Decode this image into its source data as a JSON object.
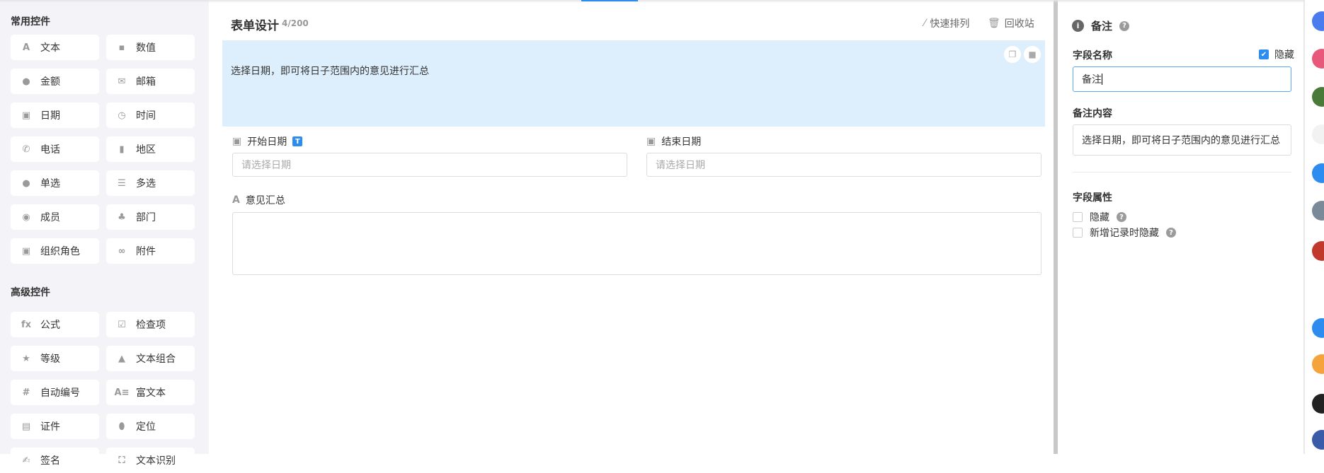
{
  "sidebar": {
    "common_title": "常用控件",
    "common": [
      {
        "label": "文本",
        "icon": "text-icon"
      },
      {
        "label": "数值",
        "icon": "number-icon"
      },
      {
        "label": "金额",
        "icon": "money-icon"
      },
      {
        "label": "邮箱",
        "icon": "mail-icon"
      },
      {
        "label": "日期",
        "icon": "calendar-icon"
      },
      {
        "label": "时间",
        "icon": "clock-icon"
      },
      {
        "label": "电话",
        "icon": "phone-icon"
      },
      {
        "label": "地区",
        "icon": "map-icon"
      },
      {
        "label": "单选",
        "icon": "radio-icon"
      },
      {
        "label": "多选",
        "icon": "checklist-icon"
      },
      {
        "label": "成员",
        "icon": "user-icon"
      },
      {
        "label": "部门",
        "icon": "org-icon"
      },
      {
        "label": "组织角色",
        "icon": "role-icon"
      },
      {
        "label": "附件",
        "icon": "paperclip-icon"
      }
    ],
    "advanced_title": "高级控件",
    "advanced": [
      {
        "label": "公式",
        "icon": "fx-icon"
      },
      {
        "label": "检查项",
        "icon": "checkbox-icon"
      },
      {
        "label": "等级",
        "icon": "star-icon"
      },
      {
        "label": "文本组合",
        "icon": "shapes-icon"
      },
      {
        "label": "自动编号",
        "icon": "hash-icon"
      },
      {
        "label": "富文本",
        "icon": "richtext-icon"
      },
      {
        "label": "证件",
        "icon": "id-card-icon"
      },
      {
        "label": "定位",
        "icon": "location-icon"
      },
      {
        "label": "签名",
        "icon": "signature-icon"
      },
      {
        "label": "文本识别",
        "icon": "ocr-icon"
      }
    ]
  },
  "main": {
    "title": "表单设计",
    "count": "4/200",
    "quick_arrange": "快速排列",
    "recycle_bin": "回收站",
    "note_text": "选择日期，即可将日子范围内的意见进行汇总",
    "start_date_label": "开始日期",
    "start_date_badge": "T",
    "end_date_label": "结束日期",
    "date_placeholder": "请选择日期",
    "summary_label": "意见汇总"
  },
  "right": {
    "title": "备注",
    "field_name_label": "字段名称",
    "hide_label": "隐藏",
    "hide_checked": true,
    "field_name_value": "备注",
    "note_content_label": "备注内容",
    "note_content_value": "选择日期，即可将日子范围内的意见进行汇总",
    "props_label": "字段属性",
    "prop_hide": "隐藏",
    "prop_hide_on_new": "新增记录时隐藏",
    "help": "?"
  },
  "avatar_colors": [
    "#4a7cf0",
    "#e8587a",
    "#4a7a3a",
    "#f2f2f2",
    "#2d8cf0",
    "#7b8a98",
    "#c0392b",
    "#ffffff",
    "#2d8cf0",
    "#f5a33b",
    "#222222",
    "#3a5ca8"
  ],
  "colors": {
    "accent": "#2d8cf0",
    "note_bg": "#ddeefc",
    "sidebar_bg": "#f3f3f8"
  }
}
